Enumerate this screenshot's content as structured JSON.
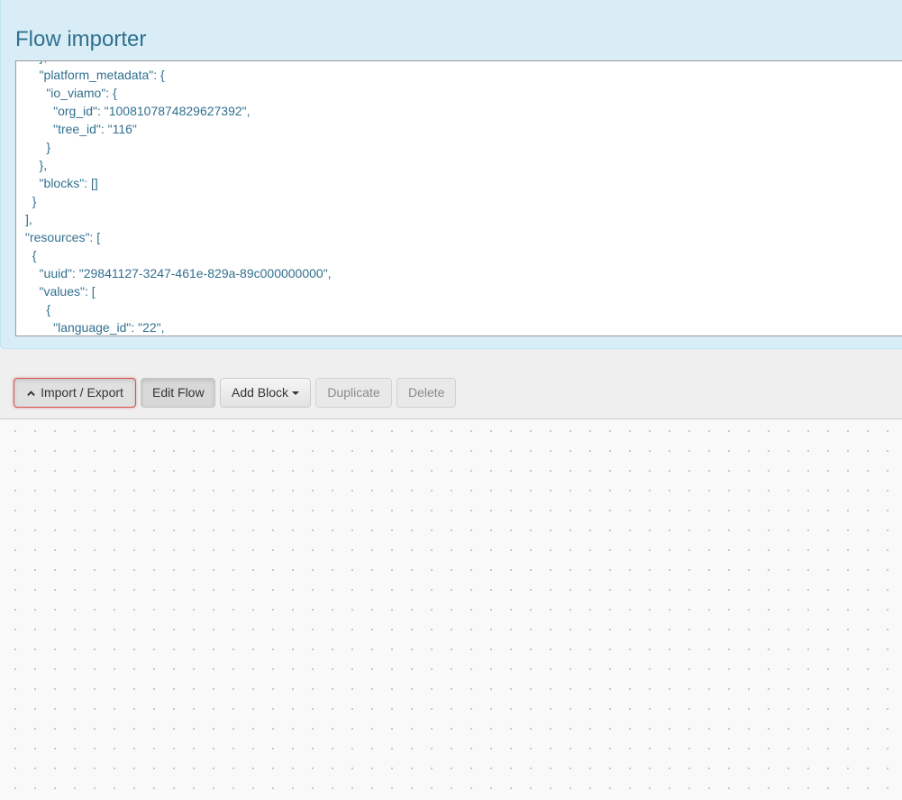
{
  "importer": {
    "title": "Flow importer",
    "json_lines": [
      "    },",
      "    \"platform_metadata\": {",
      "      \"io_viamo\": {",
      "        \"org_id\": \"1008107874829627392\",",
      "        \"tree_id\": \"116\"",
      "      }",
      "    },",
      "    \"blocks\": []",
      "  }",
      "],",
      "\"resources\": [",
      "  {",
      "    \"uuid\": \"29841127-3247-461e-829a-89c000000000\",",
      "    \"values\": [",
      "      {",
      "        \"language_id\": \"22\","
    ]
  },
  "toolbar": {
    "import_export_label": "Import / Export",
    "import_export_icon": "chevron-up-icon",
    "edit_flow_label": "Edit Flow",
    "add_block_label": "Add Block",
    "add_block_icon": "caret-down-icon",
    "duplicate_label": "Duplicate",
    "delete_label": "Delete"
  },
  "colors": {
    "panel_bg": "#d9edf7",
    "title_text": "#31708f",
    "danger_outline": "#d9534f",
    "canvas_bg": "#f9f9f9"
  }
}
